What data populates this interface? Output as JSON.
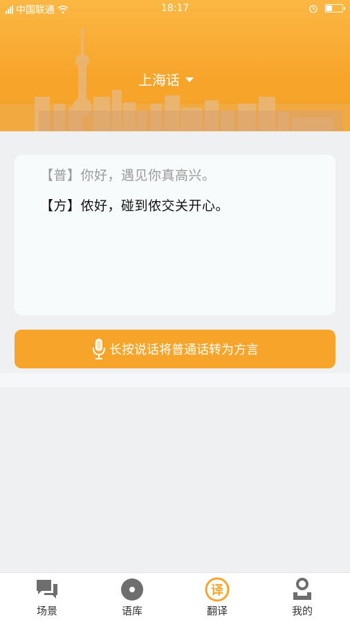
{
  "status_bar": {
    "carrier": "中国联通",
    "time": "18:17",
    "battery_level": 0.35
  },
  "header": {
    "dialect": "上海话",
    "dropdown_icon": "caret-down-icon",
    "background_icon": "shanghai-skyline"
  },
  "translation": {
    "mandarin": "【普】你好，遇见你真高兴。",
    "dialect": "【方】侬好，碰到侬交关开心。"
  },
  "record_button": {
    "label": "长按说话将普通话转为方言",
    "icon": "microphone-icon"
  },
  "bottom_nav": {
    "items": [
      {
        "label": "场景",
        "icon": "chat-bubbles-icon"
      },
      {
        "label": "语库",
        "icon": "disc-icon"
      },
      {
        "label": "翻译",
        "icon": "translate-icon",
        "active": true
      },
      {
        "label": "我的",
        "icon": "person-icon"
      }
    ]
  },
  "colors": {
    "brand": "#f6a52a",
    "background": "#eef0f1",
    "card": "#f8fbfc",
    "nav_icon": "#6e6e6e"
  }
}
